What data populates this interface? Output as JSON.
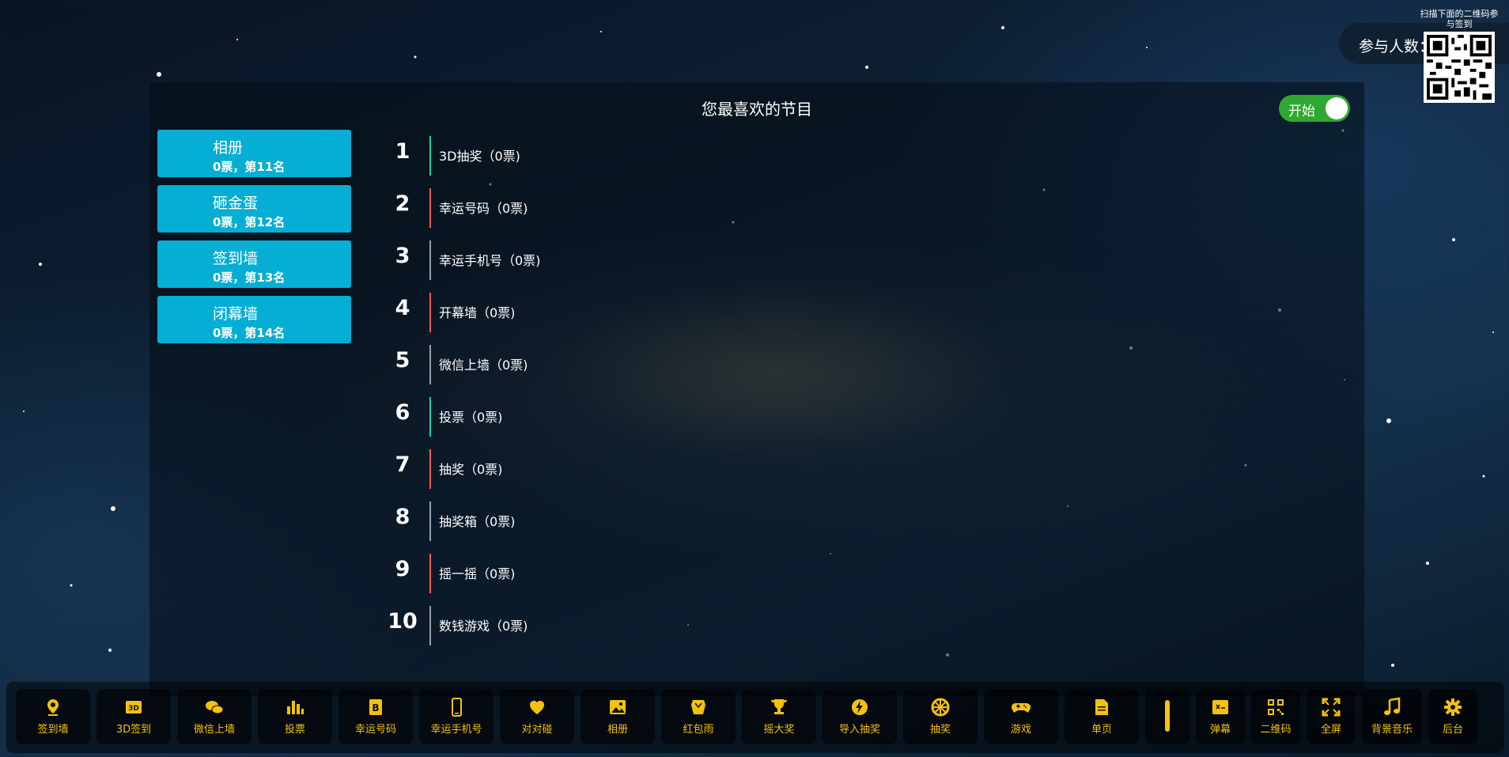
{
  "panel": {
    "title": "您最喜欢的节目",
    "toggle_label": "开始"
  },
  "cards": [
    {
      "name": "相册",
      "sub": "0票，第11名"
    },
    {
      "name": "砸金蛋",
      "sub": "0票，第12名"
    },
    {
      "name": "签到墙",
      "sub": "0票，第13名"
    },
    {
      "name": "闭幕墙",
      "sub": "0票，第14名"
    }
  ],
  "ranking": [
    {
      "rank": "1",
      "label": "3D抽奖（0票)",
      "color": "#1fd1a8"
    },
    {
      "rank": "2",
      "label": "幸运号码（0票)",
      "color": "#f05a5a"
    },
    {
      "rank": "3",
      "label": "幸运手机号（0票)",
      "color": "#9aa0a8"
    },
    {
      "rank": "4",
      "label": "开幕墙（0票)",
      "color": "#f05a5a"
    },
    {
      "rank": "5",
      "label": "微信上墙（0票)",
      "color": "#9aa0a8"
    },
    {
      "rank": "6",
      "label": "投票（0票)",
      "color": "#1fd1a8"
    },
    {
      "rank": "7",
      "label": "抽奖（0票)",
      "color": "#f05a5a"
    },
    {
      "rank": "8",
      "label": "抽奖箱（0票)",
      "color": "#9aa0a8"
    },
    {
      "rank": "9",
      "label": "摇一摇（0票)",
      "color": "#f05a5a"
    },
    {
      "rank": "10",
      "label": "数钱游戏（0票)",
      "color": "#9aa0a8"
    }
  ],
  "participants": {
    "label": "参与人数：",
    "qr_caption": "扫描下面的二维码参与签到"
  },
  "toolbar": [
    {
      "label": "签到墙",
      "icon": "map-pin-icon"
    },
    {
      "label": "3D签到",
      "icon": "3d-icon"
    },
    {
      "label": "微信上墙",
      "icon": "wechat-icon"
    },
    {
      "label": "投票",
      "icon": "bar-chart-icon"
    },
    {
      "label": "幸运号码",
      "icon": "lucky-number-icon"
    },
    {
      "label": "幸运手机号",
      "icon": "mobile-phone-icon"
    },
    {
      "label": "对对碰",
      "icon": "heart-icon"
    },
    {
      "label": "相册",
      "icon": "photo-icon"
    },
    {
      "label": "红包雨",
      "icon": "red-packet-icon"
    },
    {
      "label": "摇大奖",
      "icon": "trophy-icon"
    },
    {
      "label": "导入抽奖",
      "icon": "lightning-icon"
    },
    {
      "label": "抽奖",
      "icon": "wheel-icon"
    },
    {
      "label": "游戏",
      "icon": "gamepad-icon"
    },
    {
      "label": "单页",
      "icon": "page-icon"
    },
    {
      "label": "",
      "icon": "separator"
    },
    {
      "label": "弹幕",
      "icon": "danmaku-icon"
    },
    {
      "label": "二维码",
      "icon": "qrcode-icon"
    },
    {
      "label": "全屏",
      "icon": "fullscreen-icon"
    },
    {
      "label": "背景音乐",
      "icon": "music-icon"
    },
    {
      "label": "后台",
      "icon": "gear-icon"
    }
  ],
  "colors": {
    "accent": "#f4c20d",
    "card": "#06aed4",
    "toggle": "#2fa82f"
  }
}
